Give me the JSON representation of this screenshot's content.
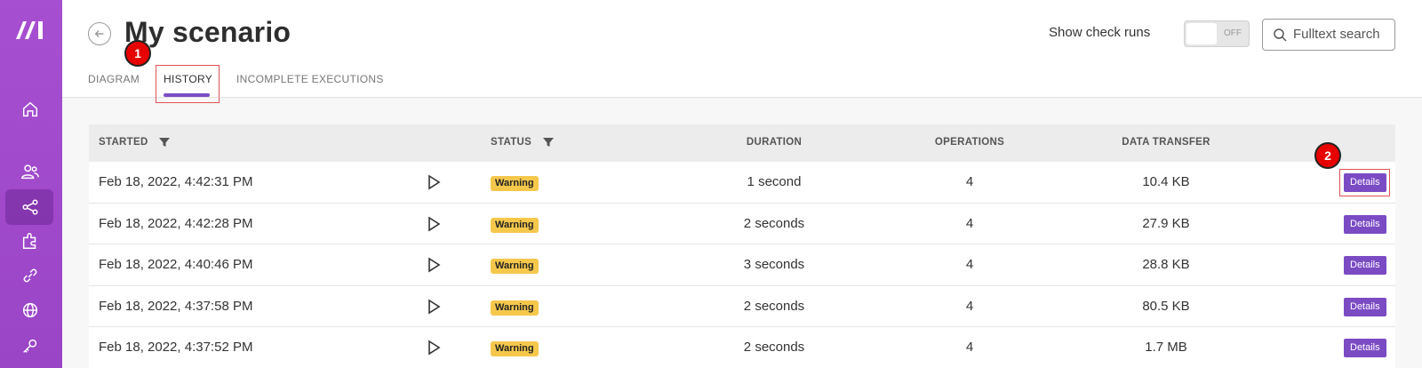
{
  "page": {
    "title": "My scenario",
    "tabs": [
      {
        "label": "DIAGRAM"
      },
      {
        "label": "HISTORY"
      },
      {
        "label": "INCOMPLETE EXECUTIONS"
      }
    ],
    "active_tab": "HISTORY",
    "show_check_runs_label": "Show check runs",
    "toggle_state": "OFF",
    "search_placeholder": "Fulltext search"
  },
  "markers": [
    "1",
    "2"
  ],
  "table": {
    "headers": [
      "STARTED",
      "STATUS",
      "DURATION",
      "OPERATIONS",
      "DATA TRANSFER"
    ],
    "rows": [
      {
        "started": "Feb 18, 2022, 4:42:31 PM",
        "status": "Warning",
        "duration": "1 second",
        "operations": "4",
        "data_transfer": "10.4 KB",
        "action": "Details"
      },
      {
        "started": "Feb 18, 2022, 4:42:28 PM",
        "status": "Warning",
        "duration": "2 seconds",
        "operations": "4",
        "data_transfer": "27.9 KB",
        "action": "Details"
      },
      {
        "started": "Feb 18, 2022, 4:40:46 PM",
        "status": "Warning",
        "duration": "3 seconds",
        "operations": "4",
        "data_transfer": "28.8 KB",
        "action": "Details"
      },
      {
        "started": "Feb 18, 2022, 4:37:58 PM",
        "status": "Warning",
        "duration": "2 seconds",
        "operations": "4",
        "data_transfer": "80.5 KB",
        "action": "Details"
      },
      {
        "started": "Feb 18, 2022, 4:37:52 PM",
        "status": "Warning",
        "duration": "2 seconds",
        "operations": "4",
        "data_transfer": "1.7 MB",
        "action": "Details"
      }
    ]
  },
  "sidebar": {
    "icons": [
      "home-icon",
      "team-icon",
      "scenarios-icon",
      "templates-icon",
      "connections-icon",
      "webhooks-icon",
      "keys-icon"
    ]
  },
  "colors": {
    "sidebar": "#a74fd1",
    "accent": "#7b4bc4",
    "warning_badge": "#f5c84c",
    "marker": "#e60000"
  }
}
